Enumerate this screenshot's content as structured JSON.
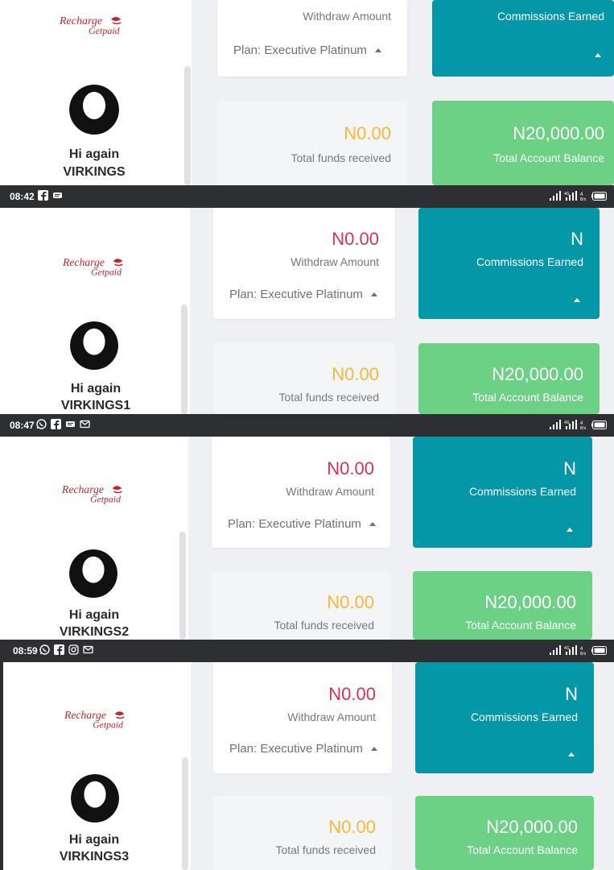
{
  "brand": {
    "logo_text_top": "Recharge",
    "logo_text_bottom": "Getpaid",
    "logo_red": "#c0282d",
    "teal": "#0397a7",
    "green": "#6cd085",
    "amount_red": "#d83352",
    "amount_orange": "#f5b83a"
  },
  "labels": {
    "withdraw_amount": "Withdraw Amount",
    "plan": "Plan: Executive Platinum",
    "commissions_earned": "Commissions Earned",
    "commissions_value": "N",
    "withdraw_value": "N0.00",
    "total_funds_value": "N0.00",
    "total_funds": "Total funds received",
    "account_balance_value": "N20,000.00",
    "account_balance": "Total Account Balance"
  },
  "screens": [
    {
      "greeting": "Hi again",
      "username": "VIRKINGS"
    },
    {
      "time": "08:42",
      "greeting": "Hi again",
      "username": "VIRKINGS1",
      "status_icons": [
        "facebook-icon",
        "message-icon"
      ]
    },
    {
      "time": "08:47",
      "greeting": "Hi again",
      "username": "VIRKINGS2",
      "status_icons": [
        "whatsapp-icon",
        "facebook-icon",
        "message-icon",
        "gmail-icon"
      ]
    },
    {
      "time": "08:59",
      "greeting": "Hi again",
      "username": "VIRKINGS3",
      "status_icons": [
        "whatsapp-icon",
        "facebook-icon",
        "instagram-icon",
        "gmail-icon"
      ]
    }
  ],
  "status_right_icons": [
    "signal-icon",
    "signal-4g-icon",
    "speed-icon",
    "battery-icon"
  ]
}
